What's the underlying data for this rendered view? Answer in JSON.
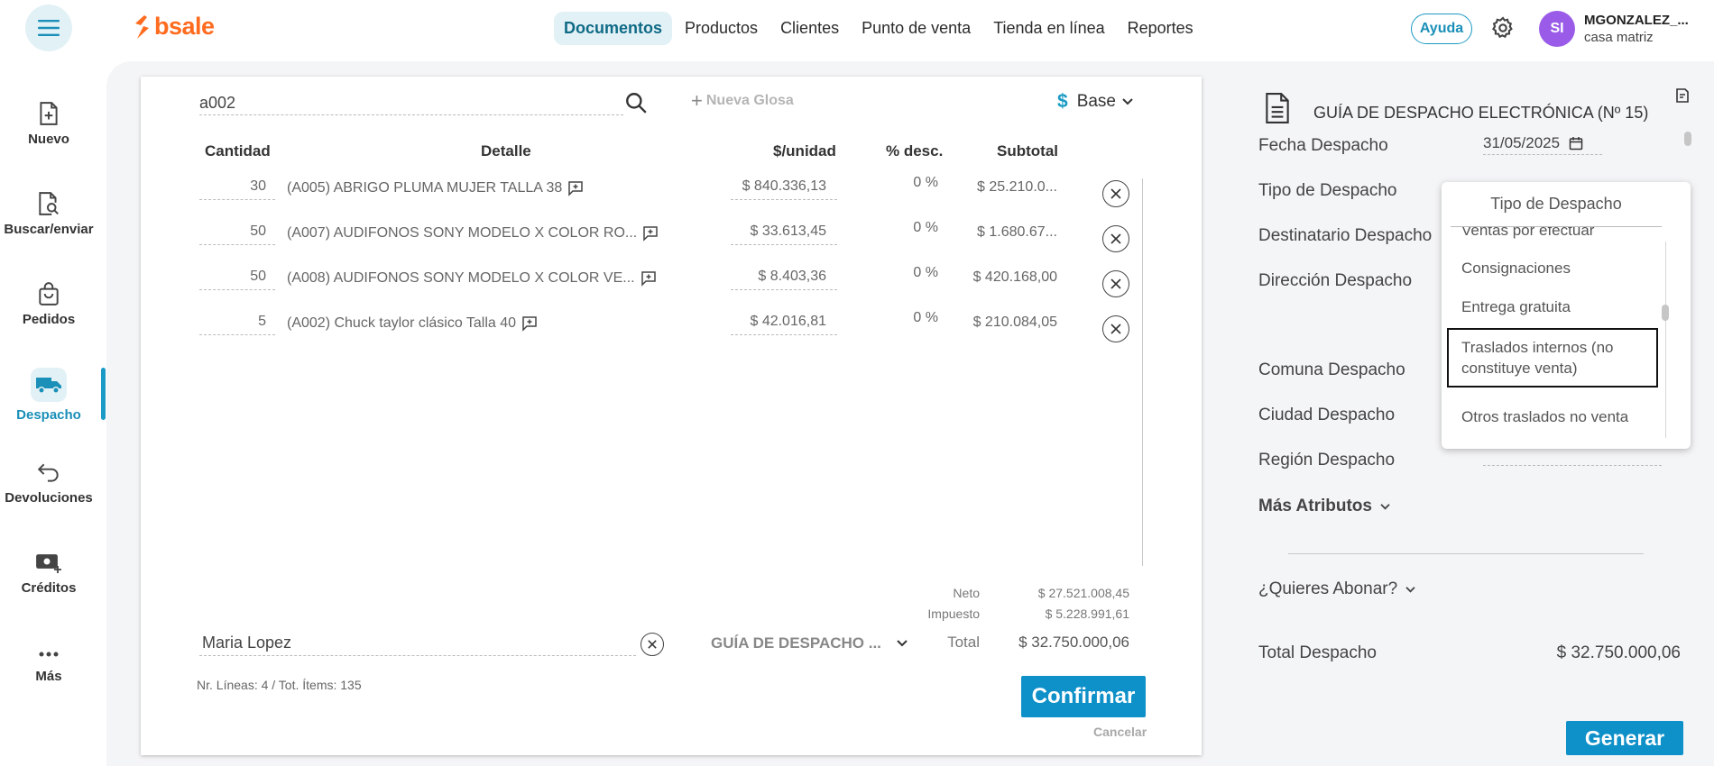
{
  "topbar": {
    "logo": "bsale",
    "nav": [
      {
        "label": "Documentos",
        "active": true
      },
      {
        "label": "Productos",
        "active": false
      },
      {
        "label": "Clientes",
        "active": false
      },
      {
        "label": "Punto de venta",
        "active": false
      },
      {
        "label": "Tienda en línea",
        "active": false
      },
      {
        "label": "Reportes",
        "active": false
      }
    ],
    "help_label": "Ayuda",
    "avatar_initials": "SI",
    "user_name": "MGONZALEZ_...",
    "user_branch": "casa matriz"
  },
  "sidebar": {
    "items": [
      {
        "label": "Nuevo",
        "icon": "file-plus-icon",
        "active": false
      },
      {
        "label": "Buscar/enviar",
        "icon": "file-search-icon",
        "active": false
      },
      {
        "label": "Pedidos",
        "icon": "shopping-bag-icon",
        "active": false
      },
      {
        "label": "Despacho",
        "icon": "truck-icon",
        "active": true
      },
      {
        "label": "Devoluciones",
        "icon": "return-arrow-icon",
        "active": false
      },
      {
        "label": "Créditos",
        "icon": "money-plus-icon",
        "active": false
      },
      {
        "label": "Más",
        "icon": "more-dots-icon",
        "active": false
      }
    ]
  },
  "document": {
    "search_value": "a002",
    "nueva_glosa": "Nueva Glosa",
    "currency_symbol": "$",
    "price_list": "Base",
    "columns": {
      "cantidad": "Cantidad",
      "detalle": "Detalle",
      "unit_price": "$/unidad",
      "discount": "% desc.",
      "subtotal": "Subtotal"
    },
    "lines": [
      {
        "qty": "30",
        "detail": "(A005) ABRIGO PLUMA MUJER TALLA 38",
        "price": "$ 840.336,13",
        "discount": "0 %",
        "subtotal": "$ 25.210.0..."
      },
      {
        "qty": "50",
        "detail": "(A007) AUDIFONOS SONY MODELO X COLOR RO...",
        "price": "$ 33.613,45",
        "discount": "0 %",
        "subtotal": "$ 1.680.67..."
      },
      {
        "qty": "50",
        "detail": "(A008) AUDIFONOS SONY MODELO X COLOR VE...",
        "price": "$ 8.403,36",
        "discount": "0 %",
        "subtotal": "$ 420.168,00"
      },
      {
        "qty": "5",
        "detail": "(A002) Chuck taylor clásico Talla 40",
        "price": "$ 42.016,81",
        "discount": "0 %",
        "subtotal": "$ 210.084,05"
      }
    ],
    "totals": {
      "neto_label": "Neto",
      "neto_value": "$ 27.521.008,45",
      "impuesto_label": "Impuesto",
      "impuesto_value": "$ 5.228.991,61",
      "total_label": "Total",
      "total_value": "$ 32.750.000,06"
    },
    "client_value": "Maria Lopez",
    "doc_type": "GUÍA DE DESPACHO ...",
    "lines_info": "Nr. Líneas: 4 / Tot. Ítems: 135",
    "confirm_label": "Confirmar",
    "cancel_label": "Cancelar"
  },
  "panel": {
    "title": "GUÍA DE DESPACHO ELECTRÓNICA (Nº 15)",
    "fecha_label": "Fecha Despacho",
    "fecha_value": "31/05/2025",
    "tipo_label": "Tipo de Despacho",
    "destinatario_label": "Destinatario Despacho",
    "direccion_label": "Dirección Despacho",
    "comuna_label": "Comuna Despacho",
    "ciudad_label": "Ciudad Despacho",
    "region_label": "Región Despacho",
    "mas_atributos": "Más Atributos",
    "abonar_label": "¿Quieres Abonar?",
    "total_label": "Total Despacho",
    "total_value": "$ 32.750.000,06",
    "generar_label": "Generar"
  },
  "dropdown": {
    "header": "Tipo de Despacho",
    "options": [
      {
        "label": "Ventas por efectuar",
        "selected": false
      },
      {
        "label": "Consignaciones",
        "selected": false
      },
      {
        "label": "Entrega gratuita",
        "selected": false
      },
      {
        "label": "Traslados internos (no constituye venta)",
        "selected": true
      },
      {
        "label": "Otros traslados no venta",
        "selected": false
      }
    ]
  }
}
